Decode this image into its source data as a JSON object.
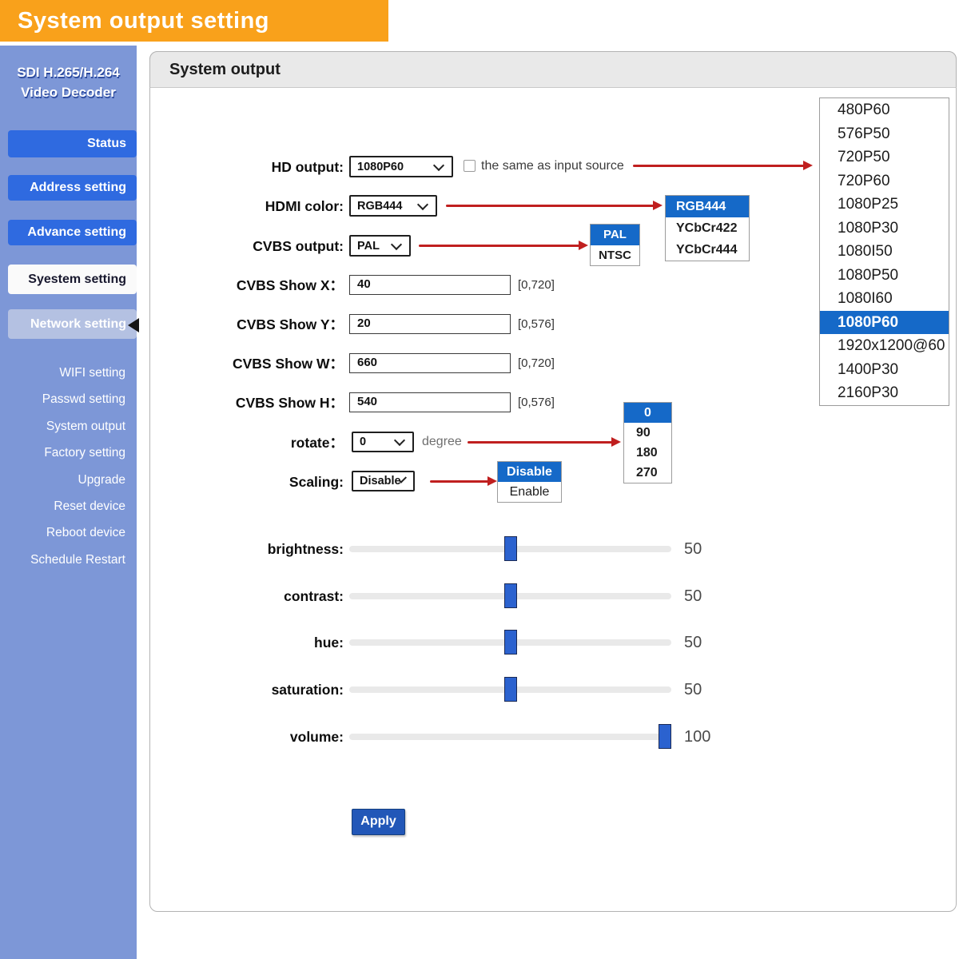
{
  "banner": {
    "title": "System output setting"
  },
  "sidebar": {
    "device_title_line1": "SDI H.265/H.264",
    "device_title_line2": "Video Decoder",
    "buttons": [
      {
        "label": "Status"
      },
      {
        "label": "Address setting"
      },
      {
        "label": "Advance setting"
      },
      {
        "label": "Syestem setting"
      },
      {
        "label": "Network setting"
      }
    ],
    "links": [
      "WIFI setting",
      "Passwd setting",
      "System output",
      "Factory setting",
      "Upgrade",
      "Reset device",
      "Reboot device",
      "Schedule Restart"
    ]
  },
  "panel": {
    "title": "System output"
  },
  "form": {
    "hd_output": {
      "label": "HD output:",
      "value": "1080P60",
      "checkbox_label": "the same as input source",
      "checkbox_checked": false
    },
    "hdmi_color": {
      "label": "HDMI color:",
      "value": "RGB444"
    },
    "cvbs_output": {
      "label": "CVBS output:",
      "value": "PAL"
    },
    "cvbs_show_x": {
      "label": "CVBS Show X：",
      "value": "40",
      "range": "[0,720]"
    },
    "cvbs_show_y": {
      "label": "CVBS Show Y：",
      "value": "20",
      "range": "[0,576]"
    },
    "cvbs_show_w": {
      "label": "CVBS Show W：",
      "value": "660",
      "range": "[0,720]"
    },
    "cvbs_show_h": {
      "label": "CVBS Show H：",
      "value": "540",
      "range": "[0,576]"
    },
    "rotate": {
      "label": "rotate：",
      "value": "0",
      "unit": "degree"
    },
    "scaling": {
      "label": "Scaling:",
      "value": "Disable"
    },
    "apply_label": "Apply"
  },
  "popups": {
    "resolutions": {
      "selected": "1080P60",
      "items": [
        "480P60",
        "576P50",
        "720P50",
        "720P60",
        "1080P25",
        "1080P30",
        "1080I50",
        "1080P50",
        "1080I60",
        "1080P60",
        "1920x1200@60",
        "1400P30",
        "2160P30"
      ]
    },
    "hdmi_colors": {
      "selected": "RGB444",
      "items": [
        "RGB444",
        "YCbCr422",
        "YCbCr444"
      ]
    },
    "cvbs_modes": {
      "selected": "PAL",
      "items": [
        "PAL",
        "NTSC"
      ]
    },
    "rotate_options": {
      "selected": "0",
      "items": [
        "0",
        "90",
        "180",
        "270"
      ]
    },
    "scaling_options": {
      "selected": "Disable",
      "items": [
        "Disable",
        "Enable"
      ]
    }
  },
  "sliders": [
    {
      "label": "brightness:",
      "value": 50,
      "max": 100
    },
    {
      "label": "contrast:",
      "value": 50,
      "max": 100
    },
    {
      "label": "hue:",
      "value": 50,
      "max": 100
    },
    {
      "label": "saturation:",
      "value": 50,
      "max": 100
    },
    {
      "label": "volume:",
      "value": 100,
      "max": 100
    }
  ],
  "colors": {
    "banner_orange": "#F9A11B",
    "sidebar_blue": "#7D97D7",
    "button_blue": "#2F6AE0",
    "highlight_blue": "#1569C8",
    "arrow_red": "#C01F1F",
    "slider_thumb_blue": "#2B62CF",
    "apply_blue": "#2257B8"
  }
}
